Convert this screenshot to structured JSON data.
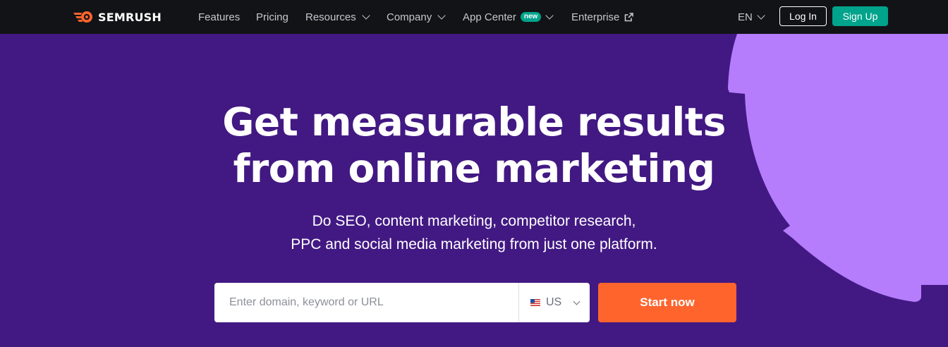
{
  "brand": {
    "name": "SEMRUSH",
    "logo_color": "#ff642d"
  },
  "nav": {
    "items": [
      {
        "label": "Features",
        "dropdown": false
      },
      {
        "label": "Pricing",
        "dropdown": false
      },
      {
        "label": "Resources",
        "dropdown": true
      },
      {
        "label": "Company",
        "dropdown": true
      },
      {
        "label": "App Center",
        "dropdown": true,
        "badge": "new"
      },
      {
        "label": "Enterprise",
        "external": true
      }
    ],
    "language": "EN",
    "login_label": "Log In",
    "signup_label": "Sign Up"
  },
  "hero": {
    "title_line1": "Get measurable results",
    "title_line2": "from online marketing",
    "subtitle_line1": "Do SEO, content marketing, competitor research,",
    "subtitle_line2": "PPC and social media marketing from just one platform.",
    "search_placeholder": "Enter domain, keyword or URL",
    "search_value": "",
    "country_code": "US",
    "start_label": "Start now"
  },
  "colors": {
    "nav_bg": "#121316",
    "hero_bg": "#421983",
    "accent_orange": "#ff642d",
    "accent_green": "#00a38b",
    "deco_purple": "#b57cfc"
  }
}
